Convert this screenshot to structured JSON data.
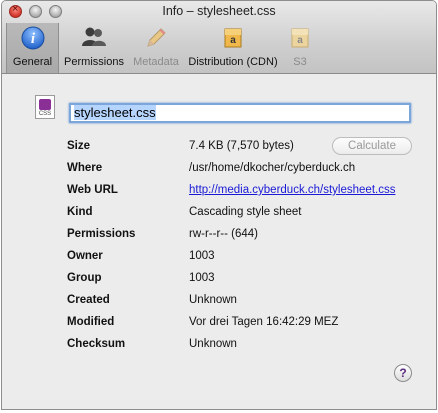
{
  "window": {
    "title": "Info – stylesheet.css"
  },
  "toolbar": {
    "items": [
      {
        "label": "General",
        "icon": "info-icon",
        "selected": true,
        "disabled": false
      },
      {
        "label": "Permissions",
        "icon": "users-icon",
        "selected": false,
        "disabled": false
      },
      {
        "label": "Metadata",
        "icon": "pencil-icon",
        "selected": false,
        "disabled": true
      },
      {
        "label": "Distribution (CDN)",
        "icon": "amazon-icon",
        "selected": false,
        "disabled": false
      },
      {
        "label": "S3",
        "icon": "s3-icon",
        "selected": false,
        "disabled": true
      }
    ]
  },
  "file": {
    "icon_label": "CSS",
    "name": "stylesheet.css"
  },
  "info": {
    "size_label": "Size",
    "size": "7.4 KB (7,570 bytes)",
    "calculate_label": "Calculate",
    "where_label": "Where",
    "where": "/usr/home/dkocher/cyberduck.ch",
    "weburl_label": "Web URL",
    "weburl": "http://media.cyberduck.ch/stylesheet.css",
    "kind_label": "Kind",
    "kind": "Cascading style sheet",
    "permissions_label": "Permissions",
    "permissions": "rw-r--r-- (644)",
    "owner_label": "Owner",
    "owner": "1003",
    "group_label": "Group",
    "group": "1003",
    "created_label": "Created",
    "created": "Unknown",
    "modified_label": "Modified",
    "modified": "Vor drei Tagen 16:42:29 MEZ",
    "checksum_label": "Checksum",
    "checksum": "Unknown"
  },
  "help": {
    "glyph": "?"
  },
  "colors": {
    "link": "#1a1ad6",
    "focus_ring": "#7aa6dc",
    "selection": "#b5d4fe"
  }
}
